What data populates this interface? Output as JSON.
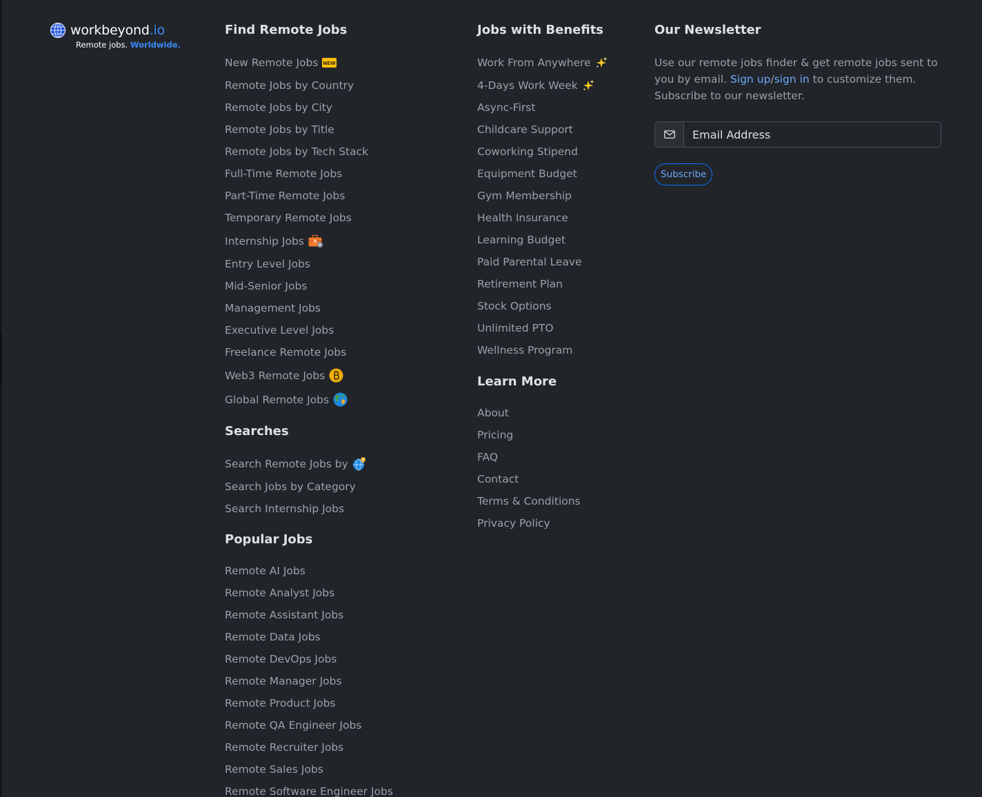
{
  "logo": {
    "name": "workbeyond",
    "tld": ".io",
    "tagline_prefix": "Remote jobs.",
    "tagline_accent": "Worldwide."
  },
  "find_remote_jobs": {
    "heading": "Find Remote Jobs",
    "items": [
      {
        "label": "New Remote Jobs",
        "icon": "new-badge-icon",
        "badge": "NEW"
      },
      {
        "label": "Remote Jobs by Country"
      },
      {
        "label": "Remote Jobs by City"
      },
      {
        "label": "Remote Jobs by Title"
      },
      {
        "label": "Remote Jobs by Tech Stack"
      },
      {
        "label": "Full-Time Remote Jobs"
      },
      {
        "label": "Part-Time Remote Jobs"
      },
      {
        "label": "Temporary Remote Jobs"
      },
      {
        "label": "Internship Jobs",
        "icon": "briefcase-icon"
      },
      {
        "label": "Entry Level Jobs"
      },
      {
        "label": "Mid-Senior Jobs"
      },
      {
        "label": "Management Jobs"
      },
      {
        "label": "Executive Level Jobs"
      },
      {
        "label": "Freelance Remote Jobs"
      },
      {
        "label": "Web3 Remote Jobs",
        "icon": "bitcoin-icon"
      },
      {
        "label": "Global Remote Jobs",
        "icon": "earth-globe-icon"
      }
    ]
  },
  "searches": {
    "heading": "Searches",
    "items": [
      {
        "label": "Search Remote Jobs by",
        "icon": "globe-pin-icon"
      },
      {
        "label": "Search Jobs by Category"
      },
      {
        "label": "Search Internship Jobs"
      }
    ]
  },
  "popular_jobs": {
    "heading": "Popular Jobs",
    "items": [
      {
        "label": "Remote AI Jobs"
      },
      {
        "label": "Remote Analyst Jobs"
      },
      {
        "label": "Remote Assistant Jobs"
      },
      {
        "label": "Remote Data Jobs"
      },
      {
        "label": "Remote DevOps Jobs"
      },
      {
        "label": "Remote Manager Jobs"
      },
      {
        "label": "Remote Product Jobs"
      },
      {
        "label": "Remote QA Engineer Jobs"
      },
      {
        "label": "Remote Recruiter Jobs"
      },
      {
        "label": "Remote Sales Jobs"
      },
      {
        "label": "Remote Software Engineer Jobs"
      }
    ]
  },
  "benefits": {
    "heading": "Jobs with Benefits",
    "items": [
      {
        "label": "Work From Anywhere",
        "icon": "sparkles-icon"
      },
      {
        "label": "4-Days Work Week",
        "icon": "sparkles-icon"
      },
      {
        "label": "Async-First"
      },
      {
        "label": "Childcare Support"
      },
      {
        "label": "Coworking Stipend"
      },
      {
        "label": "Equipment Budget"
      },
      {
        "label": "Gym Membership"
      },
      {
        "label": "Health Insurance"
      },
      {
        "label": "Learning Budget"
      },
      {
        "label": "Paid Parental Leave"
      },
      {
        "label": "Retirement Plan"
      },
      {
        "label": "Stock Options"
      },
      {
        "label": "Unlimited PTO"
      },
      {
        "label": "Wellness Program"
      }
    ]
  },
  "learn_more": {
    "heading": "Learn More",
    "items": [
      {
        "label": "About"
      },
      {
        "label": "Pricing"
      },
      {
        "label": "FAQ"
      },
      {
        "label": "Contact"
      },
      {
        "label": "Terms & Conditions"
      },
      {
        "label": "Privacy Policy"
      }
    ]
  },
  "newsletter": {
    "heading": "Our Newsletter",
    "text_before": "Use our remote jobs finder & get remote jobs sent to you by email. ",
    "signup_label": "Sign up",
    "separator": "/",
    "signin_label": "sign in",
    "text_after": " to customize them. Subscribe to our newsletter.",
    "email_placeholder": "Email Address",
    "email_value": "",
    "email_icon": "envelope-icon",
    "subscribe_label": "Subscribe"
  },
  "colors": {
    "background": "#212529",
    "heading": "#dee2e6",
    "link": "#9aa1a8",
    "accent": "#6ea8fe",
    "brand_blue": "#3d8bfd"
  }
}
